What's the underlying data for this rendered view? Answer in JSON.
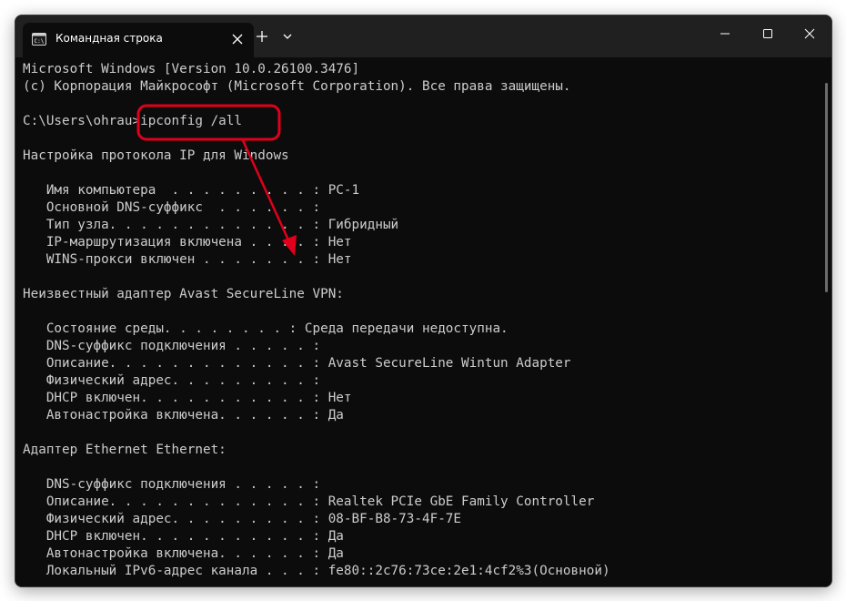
{
  "window": {
    "tab_title": "Командная строка",
    "tab_icon": "cmd-icon",
    "accent_color": "#e0001b"
  },
  "console": {
    "lines": [
      "Microsoft Windows [Version 10.0.26100.3476]",
      "(c) Корпорация Майкрософт (Microsoft Corporation). Все права защищены.",
      "",
      "C:\\Users\\ohrau>ipconfig /all",
      "",
      "Настройка протокола IP для Windows",
      "",
      "   Имя компьютера  . . . . . . . . . : PC-1",
      "   Основной DNS-суффикс  . . . . . . :",
      "   Тип узла. . . . . . . . . . . . . : Гибридный",
      "   IP-маршрутизация включена . . . . : Нет",
      "   WINS-прокси включен . . . . . . . : Нет",
      "",
      "Неизвестный адаптер Avast SecureLine VPN:",
      "",
      "   Состояние среды. . . . . . . . : Среда передачи недоступна.",
      "   DNS-суффикс подключения . . . . . :",
      "   Описание. . . . . . . . . . . . . : Avast SecureLine Wintun Adapter",
      "   Физический адрес. . . . . . . . . :",
      "   DHCP включен. . . . . . . . . . . : Нет",
      "   Автонастройка включена. . . . . . : Да",
      "",
      "Адаптер Ethernet Ethernet:",
      "",
      "   DNS-суффикс подключения . . . . . :",
      "   Описание. . . . . . . . . . . . . : Realtek PCIe GbE Family Controller",
      "   Физический адрес. . . . . . . . . : 08-BF-B8-73-4F-7E",
      "   DHCP включен. . . . . . . . . . . : Да",
      "   Автонастройка включена. . . . . . : Да",
      "   Локальный IPv6-адрес канала . . . : fe80::2c76:73ce:2e1:4cf2%3(Основной)"
    ]
  }
}
